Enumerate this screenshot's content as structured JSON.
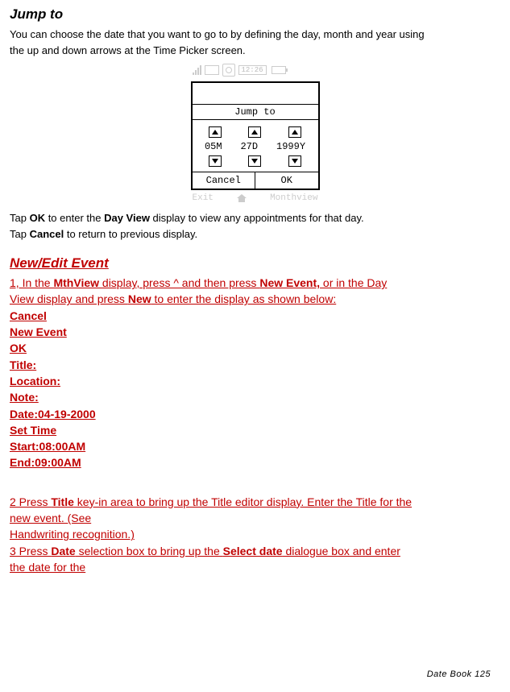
{
  "headings": {
    "jump_to": "Jump to",
    "new_edit_event": "New/Edit Event"
  },
  "intro": {
    "line1": "You can choose the date that you want to go to by defining the day, month and year using",
    "line2": "the up and down arrows at the Time Picker screen."
  },
  "device": {
    "clock": "12:26",
    "title": "Jump to",
    "month": "05M",
    "day": "27D",
    "year": "1999Y",
    "cancel": "Cancel",
    "ok": "OK",
    "soft_left": "Exit",
    "soft_right": "Monthview"
  },
  "after_device": {
    "l1_pre": "Tap ",
    "l1_b1": "OK",
    "l1_mid": " to enter the    ",
    "l1_b2": "Day View",
    "l1_post": " display to view any appointments for that day.",
    "l2_pre": "Tap ",
    "l2_b": "Cancel",
    "l2_post": "  to return to previous display."
  },
  "red": {
    "step1_a": "1,     In the  ",
    "step1_b1": "MthView",
    "step1_c": " display, press   ^ and then press   ",
    "step1_b2": "New Event,",
    "step1_d": "  or in the Day   ",
    "step1_line2a": "View display and press   ",
    "step1_b3": "New",
    "step1_line2b": "  to enter the   display as shown below:   ",
    "cancel": "Cancel",
    "new_event": "New Event",
    "ok": "OK",
    "title_field": "Title:",
    "location": "Location:",
    "note": "Note:",
    "date": "Date:04-19-2000",
    "set_time": "Set Time",
    "start": "Start:08:00AM",
    "end": "End:09:00AM",
    "step2_a": "2   Press ",
    "step2_b": "Title",
    "step2_c": " key-in area   to bring up the Title editor display. Enter the Title for the         ",
    "step2_line2": "new event. (See   ",
    "step2_line3": "Handwriting recognition.)  ",
    "step3_a": "3   Press ",
    "step3_b1": "Date",
    "step3_c": " selection box to bring up the     ",
    "step3_b2": "Select date",
    "step3_d": " dialogue box and enter   ",
    "step3_line2": "the date for the   "
  },
  "footer": "Date Book   125"
}
